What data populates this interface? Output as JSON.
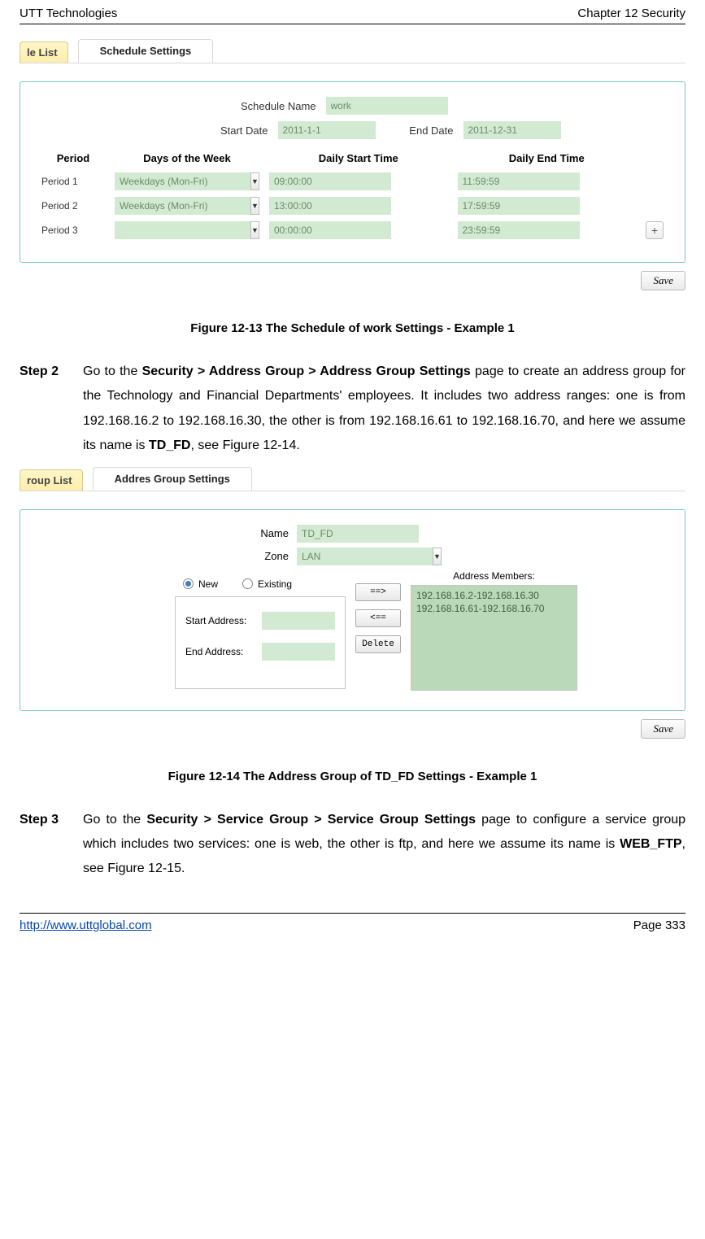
{
  "header": {
    "left": "UTT Technologies",
    "right": "Chapter 12 Security"
  },
  "schedule_panel": {
    "tab_inactive": "le List",
    "tab_active": "Schedule Settings",
    "schedule_name_label": "Schedule Name",
    "schedule_name_value": "work",
    "start_date_label": "Start Date",
    "start_date_value": "2011-1-1",
    "end_date_label": "End Date",
    "end_date_value": "2011-12-31",
    "col_period": "Period",
    "col_days": "Days of the Week",
    "col_start": "Daily Start Time",
    "col_end": "Daily End Time",
    "rows": [
      {
        "period": "Period 1",
        "days": "Weekdays (Mon-Fri)",
        "start": "09:00:00",
        "end": "11:59:59"
      },
      {
        "period": "Period 2",
        "days": "Weekdays (Mon-Fri)",
        "start": "13:00:00",
        "end": "17:59:59"
      },
      {
        "period": "Period 3",
        "days": "",
        "start": "00:00:00",
        "end": "23:59:59"
      }
    ],
    "save_label": "Save",
    "plus_label": "+"
  },
  "caption1": "Figure 12-13 The Schedule of work Settings - Example 1",
  "step2": {
    "label": "Step 2",
    "pre": "Go to the ",
    "bold1": "Security > Address Group > Address Group Settings",
    "mid": " page to create an address group for the Technology and Financial Departments' employees. It includes two address ranges: one is from 192.168.16.2 to 192.168.16.30, the other is from 192.168.16.61 to 192.168.16.70, and here we assume its name is ",
    "bold2": "TD_FD",
    "post": ", see Figure 12-14."
  },
  "ag_panel": {
    "tab_inactive": "roup List",
    "tab_active": "Addres Group Settings",
    "name_label": "Name",
    "name_value": "TD_FD",
    "zone_label": "Zone",
    "zone_value": "LAN",
    "radio_new": "New",
    "radio_existing": "Existing",
    "members_label": "Address Members:",
    "start_addr_label": "Start Address:",
    "end_addr_label": "End Address:",
    "btn_add": "==>",
    "btn_remove": "<==",
    "btn_delete": "Delete",
    "member1": "192.168.16.2-192.168.16.30",
    "member2": "192.168.16.61-192.168.16.70",
    "save_label": "Save"
  },
  "caption2": "Figure 12-14 The Address Group of TD_FD Settings - Example 1",
  "step3": {
    "label": "Step 3",
    "pre": "Go to the ",
    "bold1": "Security > Service Group > Service Group Settings",
    "mid": " page to configure a service group which includes two services: one is web, the other is ftp, and here we assume its name is ",
    "bold2": "WEB_FTP",
    "post": ", see Figure 12-15."
  },
  "footer": {
    "url": "http://www.uttglobal.com",
    "page": "Page 333"
  }
}
